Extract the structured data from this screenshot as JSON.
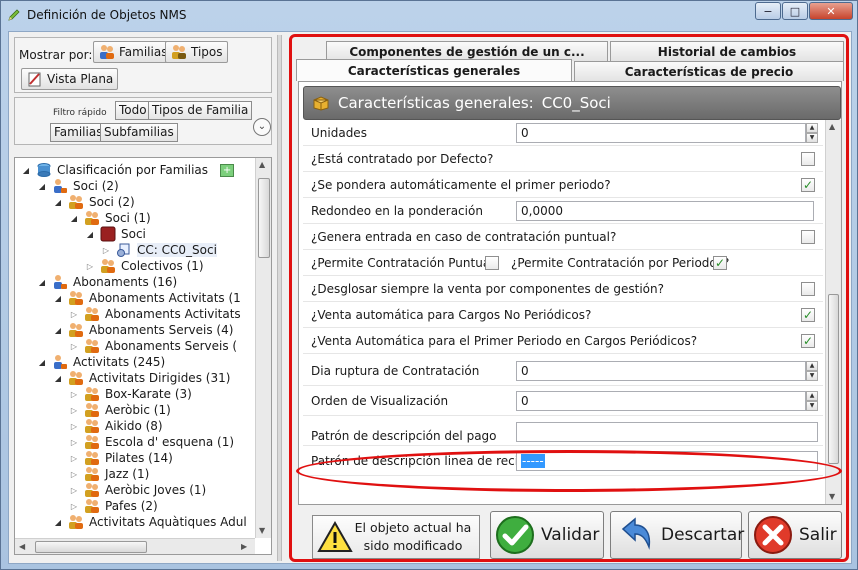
{
  "window": {
    "title": "Definición de Objetos NMS",
    "minimize_glyph": "−",
    "maximize_glyph": "□",
    "close_glyph": "✕"
  },
  "left": {
    "mostrar_label": "Mostrar por:",
    "btn_familias": "Familias",
    "btn_tipos": "Tipos",
    "btn_vista_plana": "Vista Plana",
    "filtro_label": "Filtro rápido",
    "filtro_buttons": [
      "Todo",
      "Tipos de Familia",
      "Familias",
      "Subfamilias"
    ],
    "tree": [
      {
        "label": "Clasificación por Familias",
        "icon": "database-icon",
        "expanded": true
      },
      {
        "label": "Soci  (2)",
        "icon": "family-icon",
        "expanded": true
      },
      {
        "label": "Soci  (2)",
        "icon": "subfamily-icon",
        "expanded": true
      },
      {
        "label": "Soci  (1)",
        "icon": "subfamily-icon",
        "expanded": true
      },
      {
        "label": "Soci",
        "icon": "type-icon",
        "expanded": true
      },
      {
        "label": "CC: CC0_Soci",
        "icon": "object-icon",
        "expanded": false
      },
      {
        "label": "Colectivos  (1)",
        "icon": "subfamily-icon",
        "expanded": false
      },
      {
        "label": "Abonaments  (16)",
        "icon": "family-icon",
        "expanded": true
      },
      {
        "label": "Abonaments Activitats  (1",
        "icon": "subfamily-icon",
        "expanded": true
      },
      {
        "label": "Abonaments Activitats",
        "icon": "subfamily-icon",
        "expanded": false
      },
      {
        "label": "Abonaments Serveis  (4)",
        "icon": "subfamily-icon",
        "expanded": true
      },
      {
        "label": "Abonaments Serveis  (",
        "icon": "subfamily-icon",
        "expanded": false
      },
      {
        "label": "Activitats  (245)",
        "icon": "family-icon",
        "expanded": true
      },
      {
        "label": "Activitats Dirigides  (31)",
        "icon": "subfamily-icon",
        "expanded": true
      },
      {
        "label": "Box-Karate  (3)",
        "icon": "subfamily-icon",
        "expanded": false
      },
      {
        "label": "Aeròbic  (1)",
        "icon": "subfamily-icon",
        "expanded": false
      },
      {
        "label": "Aikido  (8)",
        "icon": "subfamily-icon",
        "expanded": false
      },
      {
        "label": "Escola d' esquena  (1)",
        "icon": "subfamily-icon",
        "expanded": false
      },
      {
        "label": "Pilates  (14)",
        "icon": "subfamily-icon",
        "expanded": false
      },
      {
        "label": "Jazz  (1)",
        "icon": "subfamily-icon",
        "expanded": false
      },
      {
        "label": "Aeròbic Joves  (1)",
        "icon": "subfamily-icon",
        "expanded": false
      },
      {
        "label": "Pafes  (2)",
        "icon": "subfamily-icon",
        "expanded": false
      },
      {
        "label": "Activitats Aquàtiques Adul",
        "icon": "subfamily-icon",
        "expanded": true
      }
    ]
  },
  "tabs": {
    "row1": [
      "Componentes de gestión de un c...",
      "Historial de cambios"
    ],
    "row2": [
      "Características generales",
      "Características de precio"
    ],
    "active": "Características generales"
  },
  "section": {
    "header_prefix": "Características generales:",
    "object_code": "CC0_Soci"
  },
  "properties": [
    {
      "label": "Unidades",
      "type": "spin",
      "value": "0"
    },
    {
      "label": "¿Está contratado por Defecto?",
      "type": "check",
      "checked": false
    },
    {
      "label": "¿Se pondera automáticamente el primer periodo?",
      "type": "check",
      "checked": true
    },
    {
      "label": "Redondeo en la ponderación",
      "type": "text",
      "value": "0,0000"
    },
    {
      "label": "¿Genera entrada en caso de contratación puntual?",
      "type": "check",
      "checked": false
    },
    {
      "label": "¿Permite Contratación Puntual?",
      "type": "dual",
      "checked": false,
      "label2": "¿Permite Contratación por Periodos?",
      "checked2": true
    },
    {
      "label": "¿Desglosar siempre la venta por componentes de gestión?",
      "type": "check",
      "checked": false
    },
    {
      "label": "¿Venta automática para Cargos No Periódicos?",
      "type": "check",
      "checked": true
    },
    {
      "label": "¿Venta Automática para el Primer Periodo en Cargos Periódicos?",
      "type": "check",
      "checked": true
    },
    {
      "label": "Dia ruptura de Contratación",
      "type": "spin",
      "value": "0"
    },
    {
      "label": "Orden de Visualización",
      "type": "spin",
      "value": "0"
    },
    {
      "label": "Patrón de descripción del pago",
      "type": "text",
      "value": ""
    },
    {
      "label": "Patrón de descripción linea de recibo",
      "type": "text",
      "value": "-----"
    }
  ],
  "bottom": {
    "warning_line1": "El objeto actual ha",
    "warning_line2": "sido modificado",
    "validar": "Validar",
    "descartar": "Descartar",
    "salir": "Salir"
  },
  "check_glyph": "✓",
  "colors": {
    "highlight_red": "#e01010",
    "section_header": "#7a7a7a",
    "selection_blue": "#3399ff",
    "check_green": "#2a8f2a"
  }
}
